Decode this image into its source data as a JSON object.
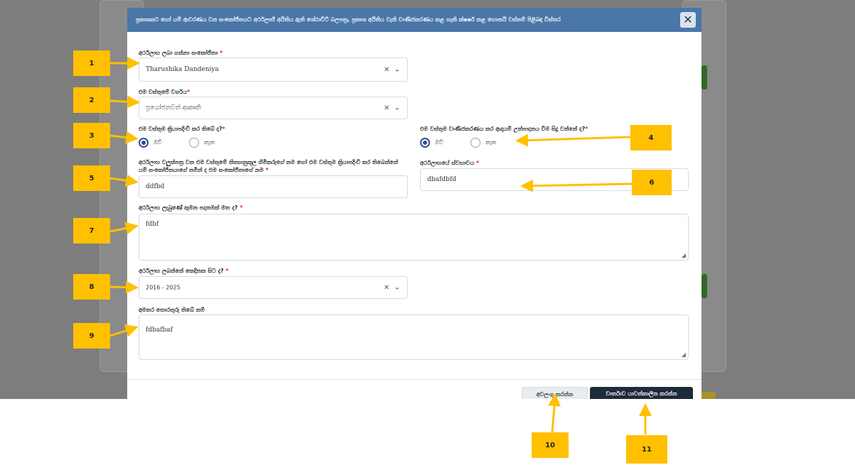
{
  "modal": {
    "title": "ප්‍රකාශකට හෝ යම් ආවරණය වන සංකෝජිතයට අර්ථලාභී අයිතිය ඇති ශේඨාවිට් බලපත්‍ර, ප්‍රකාශ අයිතිය වැනි වාණිජකරණය කළ හැකි ක්ෂර්ෂ කළ හොනයි වස්තම් පිළිබඳ විස්තර",
    "close_label": "✕"
  },
  "form": {
    "beneficiary": {
      "label": "අර්ථලාභ ලබා ගන්නා සංකෝජිතා",
      "value": "Tharushika Dandeniya"
    },
    "asset_type": {
      "label": "එම වස්තුමේ වර්ගය",
      "value": "ප්‍රයෝජනවත් ආකෘති"
    },
    "in_operation": {
      "label": "එම වස්තුම ක්‍රියාපදිංචි කර තිබේ ද?",
      "options": [
        "ඔව්",
        "නැත"
      ],
      "selected": "ඔව්"
    },
    "commercialized": {
      "label": "එම වස්තුම වාණිජකරණය කර ආදායම් උත්පාදනය වීම සිදු වන්නේ ද?",
      "options": [
        "ඔව්",
        "නැත"
      ],
      "selected": "ඔව්"
    },
    "registered_name": {
      "label": "අර්ථලාභ වලුක්පත්‍ර වන එම වස්තුමේ නිත්‍යානුකූල හිමිකරුගේ නම හෝ එම වස්තුම ක්‍රියාපදිංචි කර තිබෙන්නේ යම් සංකෝජිතයාගේ නමින් ද එම සංකෝජිතාගේ නම",
      "value": "ddfbd"
    },
    "nature": {
      "label": "අර්ථලාභයේ ස්වභාවය",
      "value": "dbafdbfd"
    },
    "basis": {
      "label": "අර්ථලාභ ලැබුණේ කුමන පදනමක් මත ද?",
      "value": "fdbf"
    },
    "since": {
      "label": "අර්ථලාභ ලබන්නේ කෙදිනක සිට ද?",
      "value": "2016 - 2025"
    },
    "other_info": {
      "label": "අමතර තොරතුරු තිබේ නම්",
      "value": "fdbafbaf"
    }
  },
  "footer": {
    "cancel_label": "අවලංගු කරන්න",
    "save_label": "වාර්තාව යාවත්කාලීන කරන්න"
  },
  "select_controls": {
    "clear_symbol": "×",
    "chevron_symbol": "⌄"
  },
  "callouts": [
    "1",
    "2",
    "3",
    "4",
    "5",
    "6",
    "7",
    "8",
    "9",
    "10",
    "11"
  ],
  "colors": {
    "header": "#4a76a8",
    "callout": "#ffc000",
    "save_button": "#1d2b3a",
    "required": "#d9282f"
  }
}
